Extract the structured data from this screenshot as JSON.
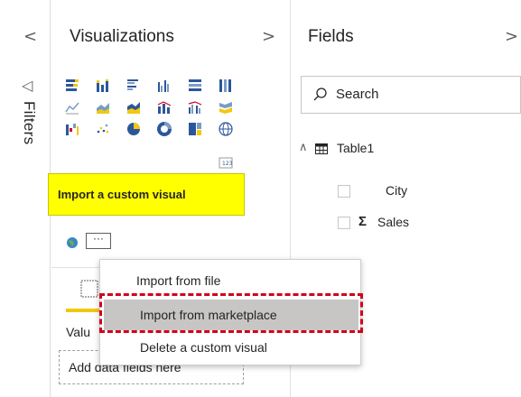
{
  "filters": {
    "label": "Filters",
    "collapse_icon": "chevron-left-icon",
    "funnel_icon": "funnel-icon"
  },
  "visualizations": {
    "title": "Visualizations",
    "expand_icon": "chevron-right-icon",
    "more_label": "···",
    "values_label": "Valu",
    "add_fields_placeholder": "Add data fields here",
    "accent_color": "#f2c811"
  },
  "tooltip": {
    "text": "Import a custom visual",
    "color": "#ffff00"
  },
  "context_menu": {
    "items": [
      {
        "label": "Import from file"
      },
      {
        "label": "Import from marketplace"
      },
      {
        "label": "Delete a custom visual"
      }
    ],
    "highlight_color": "#d0021b"
  },
  "fields": {
    "title": "Fields",
    "expand_icon": "chevron-right-icon",
    "search_placeholder": "Search",
    "table_name": "Table1",
    "columns": [
      {
        "name": "City",
        "type": "text"
      },
      {
        "name": "Sales",
        "type": "measure",
        "symbol": "Σ"
      }
    ]
  }
}
